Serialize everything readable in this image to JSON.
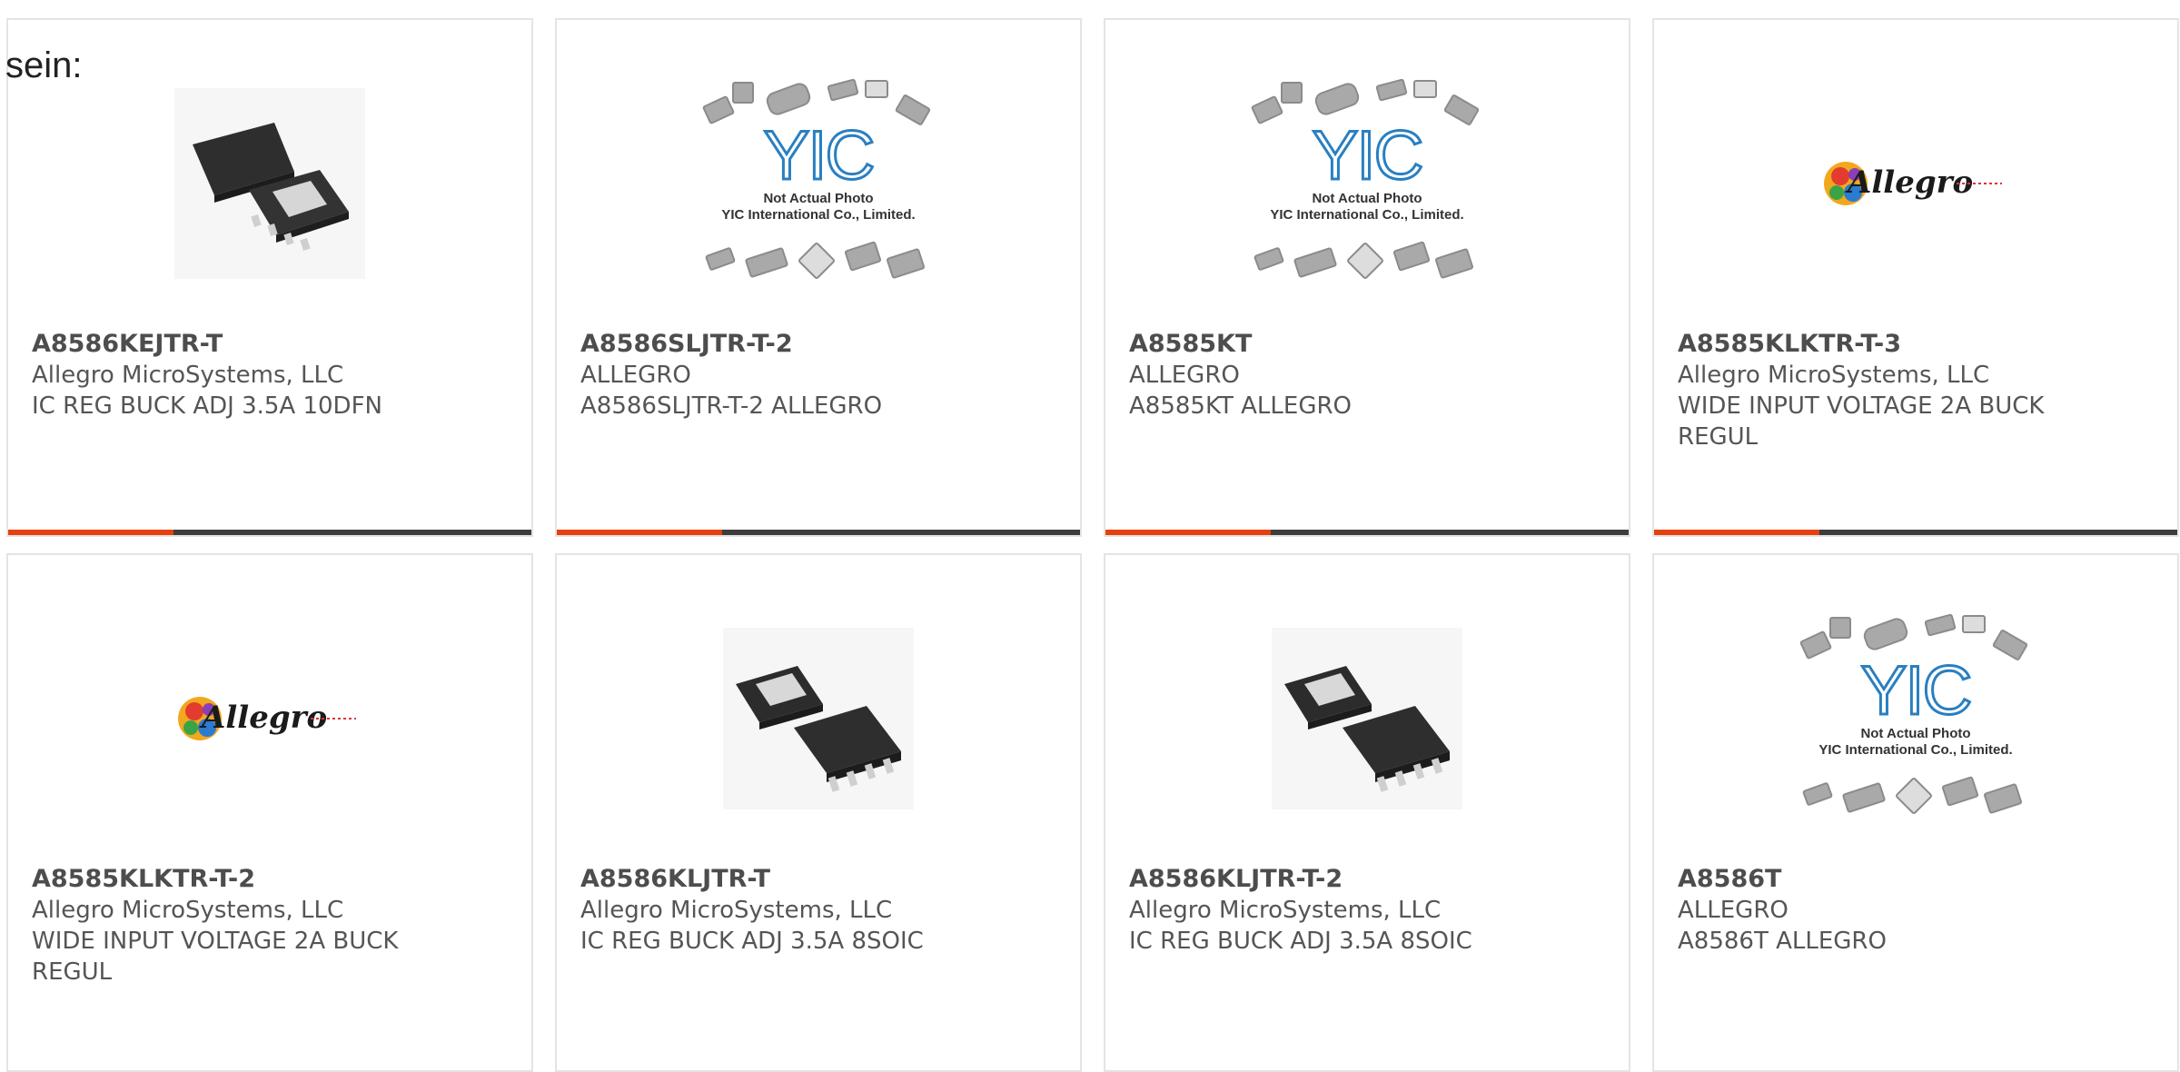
{
  "heading": "sein:",
  "colors": {
    "accent": "#e6400f",
    "bar": "#3d3d3d",
    "border": "#e4e4e4"
  },
  "placeholder": {
    "monogram": "YIC",
    "line1": "Not Actual Photo",
    "line2": "YIC International Co., Limited."
  },
  "brand_logo_text": "Allegro",
  "products": [
    {
      "part": "A8586KEJTR-T",
      "manufacturer": "Allegro MicroSystems, LLC",
      "description": "IC REG BUCK ADJ 3.5A 10DFN",
      "image": "dfn-chip-photo",
      "accent_bar": true
    },
    {
      "part": "A8586SLJTR-T-2",
      "manufacturer": "ALLEGRO",
      "description": "A8586SLJTR-T-2 ALLEGRO",
      "image": "not-actual-photo",
      "accent_bar": true
    },
    {
      "part": "A8585KT",
      "manufacturer": "ALLEGRO",
      "description": "A8585KT ALLEGRO",
      "image": "not-actual-photo",
      "accent_bar": true
    },
    {
      "part": "A8585KLKTR-T-3",
      "manufacturer": "Allegro MicroSystems, LLC",
      "description": "WIDE INPUT VOLTAGE 2A BUCK REGUL",
      "image": "allegro-logo",
      "accent_bar": true
    },
    {
      "part": "A8585KLKTR-T-2",
      "manufacturer": "Allegro MicroSystems, LLC",
      "description": "WIDE INPUT VOLTAGE 2A BUCK REGUL",
      "image": "allegro-logo",
      "accent_bar": false
    },
    {
      "part": "A8586KLJTR-T",
      "manufacturer": "Allegro MicroSystems, LLC",
      "description": "IC REG BUCK ADJ 3.5A 8SOIC",
      "image": "soic-chip-photo",
      "accent_bar": false
    },
    {
      "part": "A8586KLJTR-T-2",
      "manufacturer": "Allegro MicroSystems, LLC",
      "description": "IC REG BUCK ADJ 3.5A 8SOIC",
      "image": "soic-chip-photo",
      "accent_bar": false
    },
    {
      "part": "A8586T",
      "manufacturer": "ALLEGRO",
      "description": "A8586T ALLEGRO",
      "image": "not-actual-photo",
      "accent_bar": false
    }
  ]
}
